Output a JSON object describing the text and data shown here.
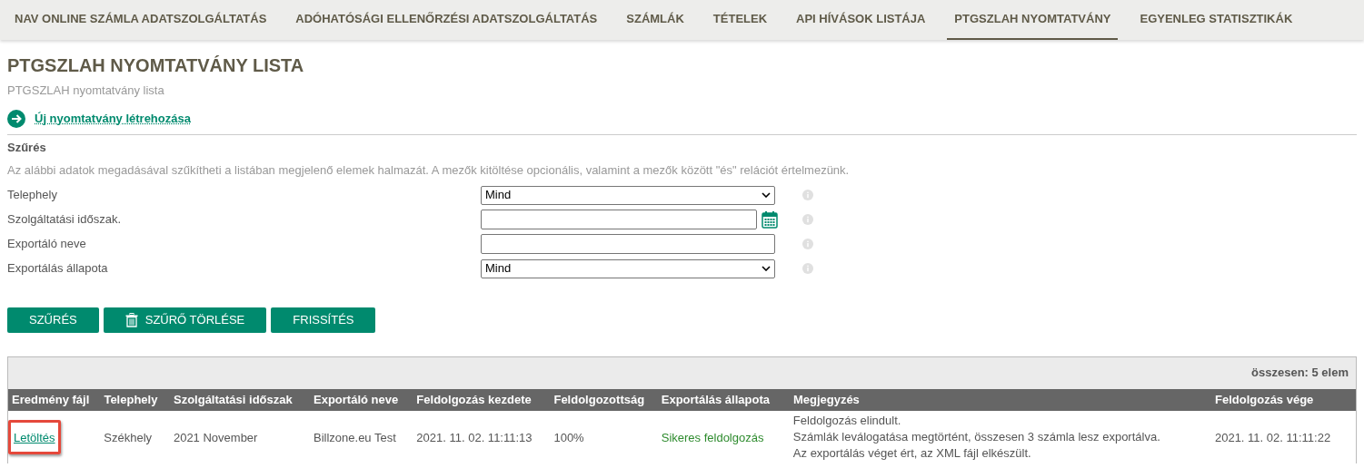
{
  "nav": {
    "tabs": [
      {
        "label": "NAV ONLINE SZÁMLA ADATSZOLGÁLTATÁS",
        "selected": false
      },
      {
        "label": "ADÓHATÓSÁGI ELLENŐRZÉSI ADATSZOLGÁLTATÁS",
        "selected": false
      },
      {
        "label": "SZÁMLÁK",
        "selected": false
      },
      {
        "label": "TÉTELEK",
        "selected": false
      },
      {
        "label": "API HÍVÁSOK LISTÁJA",
        "selected": false
      },
      {
        "label": "PTGSZLAH NYOMTATVÁNY",
        "selected": true
      },
      {
        "label": "EGYENLEG STATISZTIKÁK",
        "selected": false
      }
    ]
  },
  "page": {
    "title": "PTGSZLAH NYOMTATVÁNY LISTA",
    "subtitle": "PTGSZLAH nyomtatvány lista",
    "create_link": "Új nyomtatvány létrehozása"
  },
  "filter": {
    "title": "Szűrés",
    "description": "Az alábbi adatok megadásával szűkítheti a listában megjelenő elemek halmazát. A mezők kitöltése opcionális, valamint a mezők között \"és\" relációt értelmezünk.",
    "fields": [
      {
        "label": "Telephely",
        "kind": "select",
        "value": "Mind"
      },
      {
        "label": "Szolgáltatási időszak.",
        "kind": "date"
      },
      {
        "label": "Exportáló neve",
        "kind": "text"
      },
      {
        "label": "Exportálás állapota",
        "kind": "select",
        "value": "Mind"
      }
    ],
    "buttons": [
      {
        "label": "SZŰRÉS",
        "kind": "plain"
      },
      {
        "label": "SZŰRŐ TÖRLÉSE",
        "kind": "trash"
      },
      {
        "label": "FRISSÍTÉS",
        "kind": "plain"
      }
    ]
  },
  "table": {
    "total": "összesen: 5 elem",
    "columns": [
      "Eredmény fájl",
      "Telephely",
      "Szolgáltatási időszak",
      "Exportáló neve",
      "Feldolgozás kezdete",
      "Feldolgozottság",
      "Exportálás állapota",
      "Megjegyzés",
      "Feldolgozás vége"
    ],
    "rows": [
      {
        "file_link": "Letöltés",
        "highlighted": true,
        "site": "Székhely",
        "period": "2021 November",
        "exporter": "Billzone.eu Test",
        "start": "2021. 11. 02. 11:11:13",
        "progress": "100%",
        "status": {
          "text": "Sikeres feldolgozás",
          "kind": "success"
        },
        "notes": [
          "Feldolgozás elindult.",
          "Számlák leválogatása megtörtént, összesen 3 számla lesz exportálva.",
          "Az exportálás véget ért, az XML fájl elkészült."
        ],
        "end": "2021. 11. 02. 11:11:22"
      }
    ]
  }
}
